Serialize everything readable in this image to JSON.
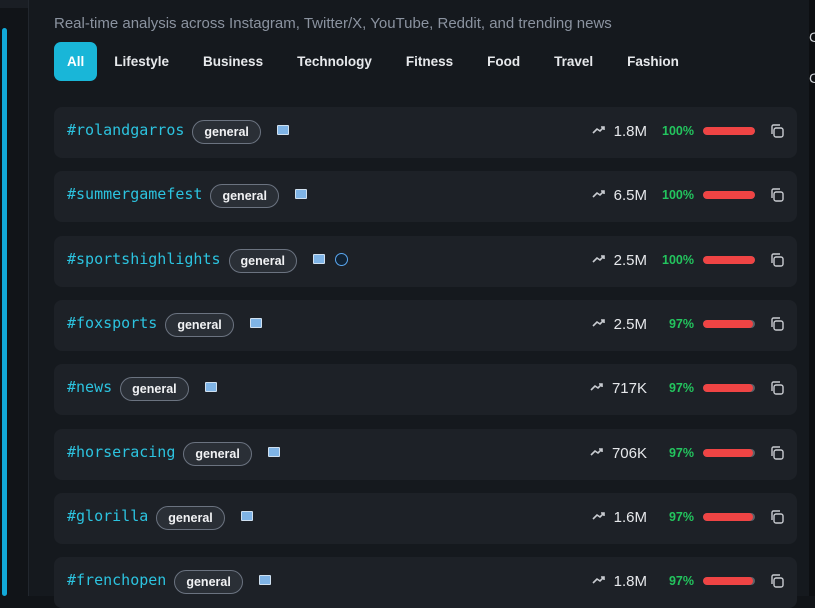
{
  "header": {
    "subtitle": "Real-time analysis across Instagram, Twitter/X, YouTube, Reddit, and trending news"
  },
  "tabs": [
    {
      "label": "All",
      "active": true
    },
    {
      "label": "Lifestyle",
      "active": false
    },
    {
      "label": "Business",
      "active": false
    },
    {
      "label": "Technology",
      "active": false
    },
    {
      "label": "Fitness",
      "active": false
    },
    {
      "label": "Food",
      "active": false
    },
    {
      "label": "Travel",
      "active": false
    },
    {
      "label": "Fashion",
      "active": false
    }
  ],
  "rows": [
    {
      "hashtag": "#rolandgarros",
      "category": "general",
      "sources": [
        "tv-icon"
      ],
      "count": "1.8M",
      "score": "100%",
      "score_value": 1.0
    },
    {
      "hashtag": "#summergamefest",
      "category": "general",
      "sources": [
        "tv-icon"
      ],
      "count": "6.5M",
      "score": "100%",
      "score_value": 1.0
    },
    {
      "hashtag": "#sportshighlights",
      "category": "general",
      "sources": [
        "tv-icon",
        "globe-icon"
      ],
      "count": "2.5M",
      "score": "100%",
      "score_value": 1.0
    },
    {
      "hashtag": "#foxsports",
      "category": "general",
      "sources": [
        "tv-icon"
      ],
      "count": "2.5M",
      "score": "97%",
      "score_value": 0.97
    },
    {
      "hashtag": "#news",
      "category": "general",
      "sources": [
        "tv-icon"
      ],
      "count": "717K",
      "score": "97%",
      "score_value": 0.97
    },
    {
      "hashtag": "#horseracing",
      "category": "general",
      "sources": [
        "tv-icon"
      ],
      "count": "706K",
      "score": "97%",
      "score_value": 0.97
    },
    {
      "hashtag": "#glorilla",
      "category": "general",
      "sources": [
        "tv-icon"
      ],
      "count": "1.6M",
      "score": "97%",
      "score_value": 0.97
    },
    {
      "hashtag": "#frenchopen",
      "category": "general",
      "sources": [
        "tv-icon"
      ],
      "count": "1.8M",
      "score": "97%",
      "score_value": 0.97
    }
  ],
  "colors": {
    "accent": "#19b6d8",
    "hashtag": "#2cc3df",
    "positive": "#23c55e",
    "bar_fill": "#ef4444"
  }
}
